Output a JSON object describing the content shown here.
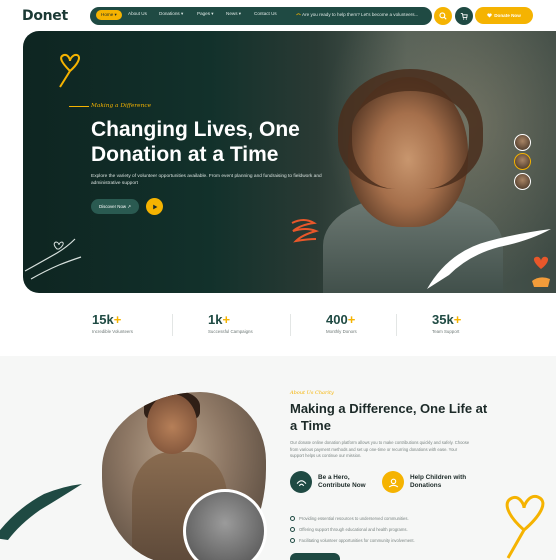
{
  "brand": {
    "name": "Donet"
  },
  "nav": {
    "items": [
      {
        "label": "Home ▾",
        "active": true
      },
      {
        "label": "About Us",
        "active": false
      },
      {
        "label": "Donations ▾",
        "active": false
      },
      {
        "label": "Pages ▾",
        "active": false
      },
      {
        "label": "News ▾",
        "active": false
      },
      {
        "label": "Contact Us",
        "active": false
      }
    ],
    "promo": "Are you ready to help them? Let's become a volunteers...",
    "donate_label": "Donate Now",
    "icons": {
      "search": "search-icon",
      "cart": "cart-icon",
      "heart": "heart-icon"
    }
  },
  "hero": {
    "eyebrow": "Making a Difference",
    "title": "Changing Lives, One Donation at a Time",
    "description": "Explore the variety of volunteer opportunities available. From event planning and fundraising to fieldwork and administrative support",
    "discover_label": "Discover Now ↗",
    "colors": {
      "accent": "#f5b301",
      "dark": "#1f4a43"
    }
  },
  "stats": [
    {
      "value": "15k",
      "suffix": "+",
      "label": "Incredible Volunteers"
    },
    {
      "value": "1k",
      "suffix": "+",
      "label": "Successful Campaigns"
    },
    {
      "value": "400",
      "suffix": "+",
      "label": "Monthly Donors"
    },
    {
      "value": "35k",
      "suffix": "+",
      "label": "Team Support"
    }
  ],
  "about": {
    "eyebrow": "About Us Charity",
    "title": "Making a Difference, One Life at a Time",
    "description": "Our donate online donation platform allows you to make contributions quickly and safely. Choose from various payment methods and set up one-time or recurring donations with ease. Your support helps us continue our mission.",
    "features": [
      {
        "label": "Be a Hero, Contribute Now",
        "icon": "hands-icon"
      },
      {
        "label": "Help Children with Donations",
        "icon": "donation-icon"
      }
    ],
    "checks": [
      "Providing essential resources to underserved communities.",
      "Offering support through educational and health programs.",
      "Facilitating volunteer opportunities for community involvement."
    ]
  }
}
